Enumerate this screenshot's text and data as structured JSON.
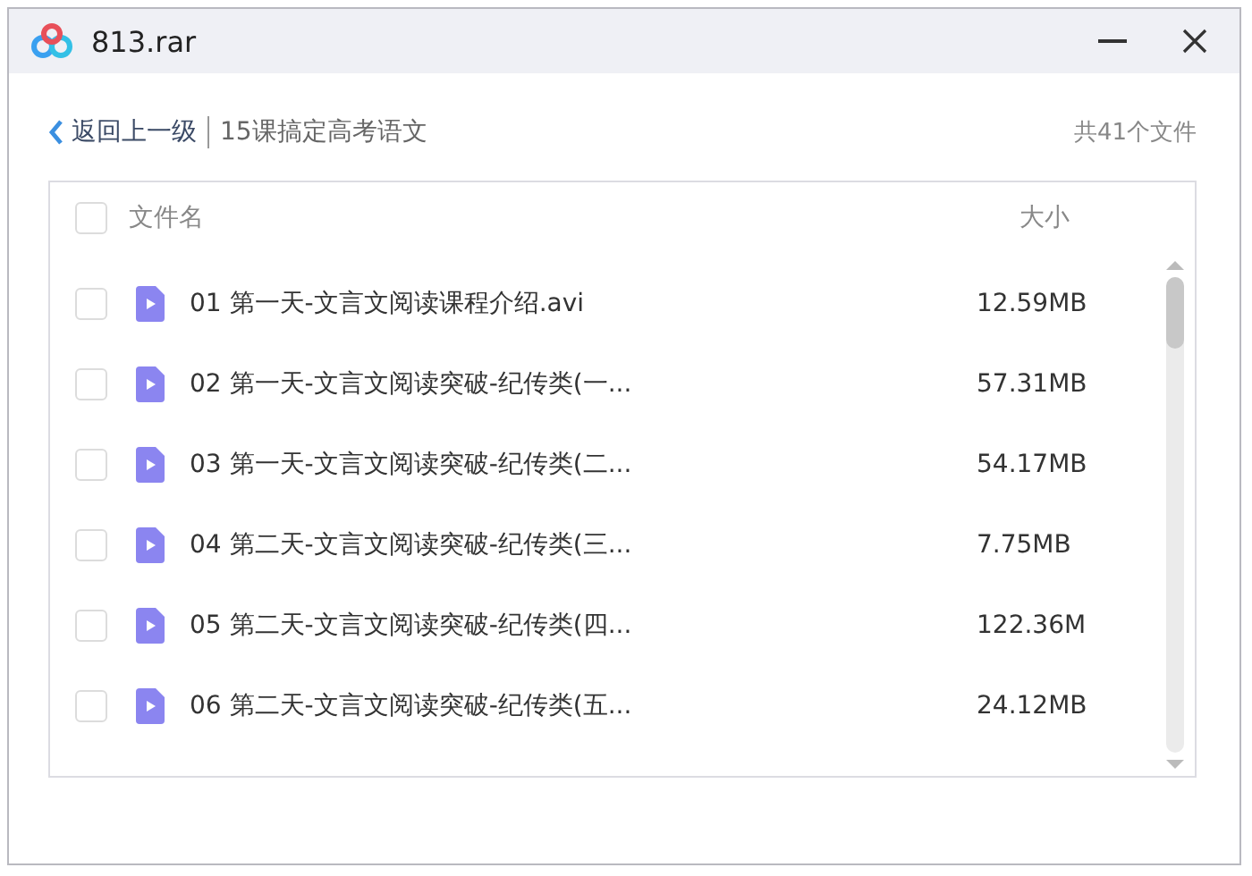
{
  "window": {
    "title": "813.rar"
  },
  "nav": {
    "back_label": "返回上一级",
    "path": "15课搞定高考语文",
    "count": "共41个文件"
  },
  "table": {
    "select_all_checked": false,
    "columns": [
      "文件名",
      "大小"
    ],
    "rows": [
      {
        "name": "01 第一天-文言文阅读课程介绍.avi",
        "size": "12.59MB",
        "checked": false
      },
      {
        "name": "02 第一天-文言文阅读突破-纪传类(一...",
        "size": "57.31MB",
        "checked": false
      },
      {
        "name": "03 第一天-文言文阅读突破-纪传类(二...",
        "size": "54.17MB",
        "checked": false
      },
      {
        "name": "04 第二天-文言文阅读突破-纪传类(三...",
        "size": "7.75MB",
        "checked": false
      },
      {
        "name": "05 第二天-文言文阅读突破-纪传类(四...",
        "size": "122.36M",
        "checked": false
      },
      {
        "name": "06 第二天-文言文阅读突破-纪传类(五...",
        "size": "24.12MB",
        "checked": false
      }
    ]
  }
}
